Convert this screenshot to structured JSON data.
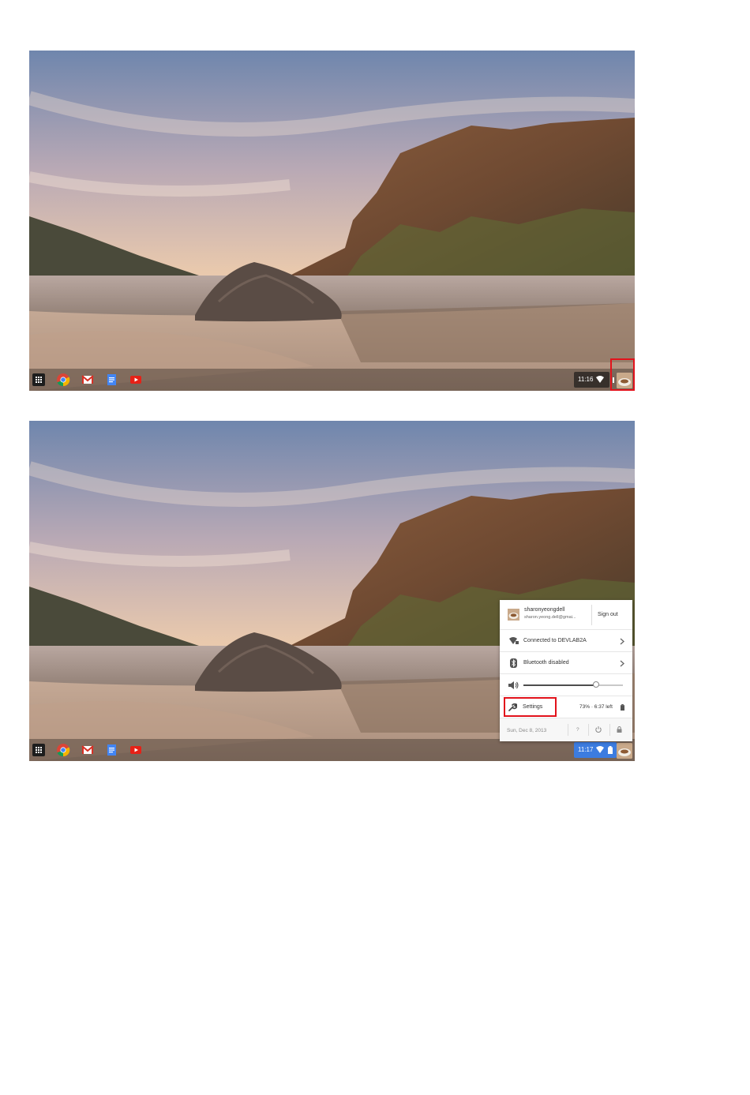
{
  "screens": [
    {
      "clock": "11:16",
      "status_active": false
    },
    {
      "clock": "11:17",
      "status_active": true,
      "tray": {
        "user_name": "sharonyeongdell",
        "user_email": "sharon.yeong.dell@gmai...",
        "sign_out_label": "Sign out",
        "network_label": "Connected to DEVLAB2A",
        "bluetooth_label": "Bluetooth disabled",
        "volume_level": 0.73,
        "settings_label": "Settings",
        "battery_label": "73% · 6:37 left",
        "date_label": "Sun, Dec 8, 2013",
        "help_label": "?"
      }
    }
  ],
  "shelf_apps": [
    "app-launcher-icon",
    "chrome-icon",
    "gmail-icon",
    "docs-icon",
    "youtube-icon"
  ],
  "colors": {
    "highlight": "#e2121b",
    "status_active": "#3c7ce0",
    "gmail_red": "#d93025",
    "docs_blue": "#4285f4",
    "youtube_red": "#e62117"
  }
}
